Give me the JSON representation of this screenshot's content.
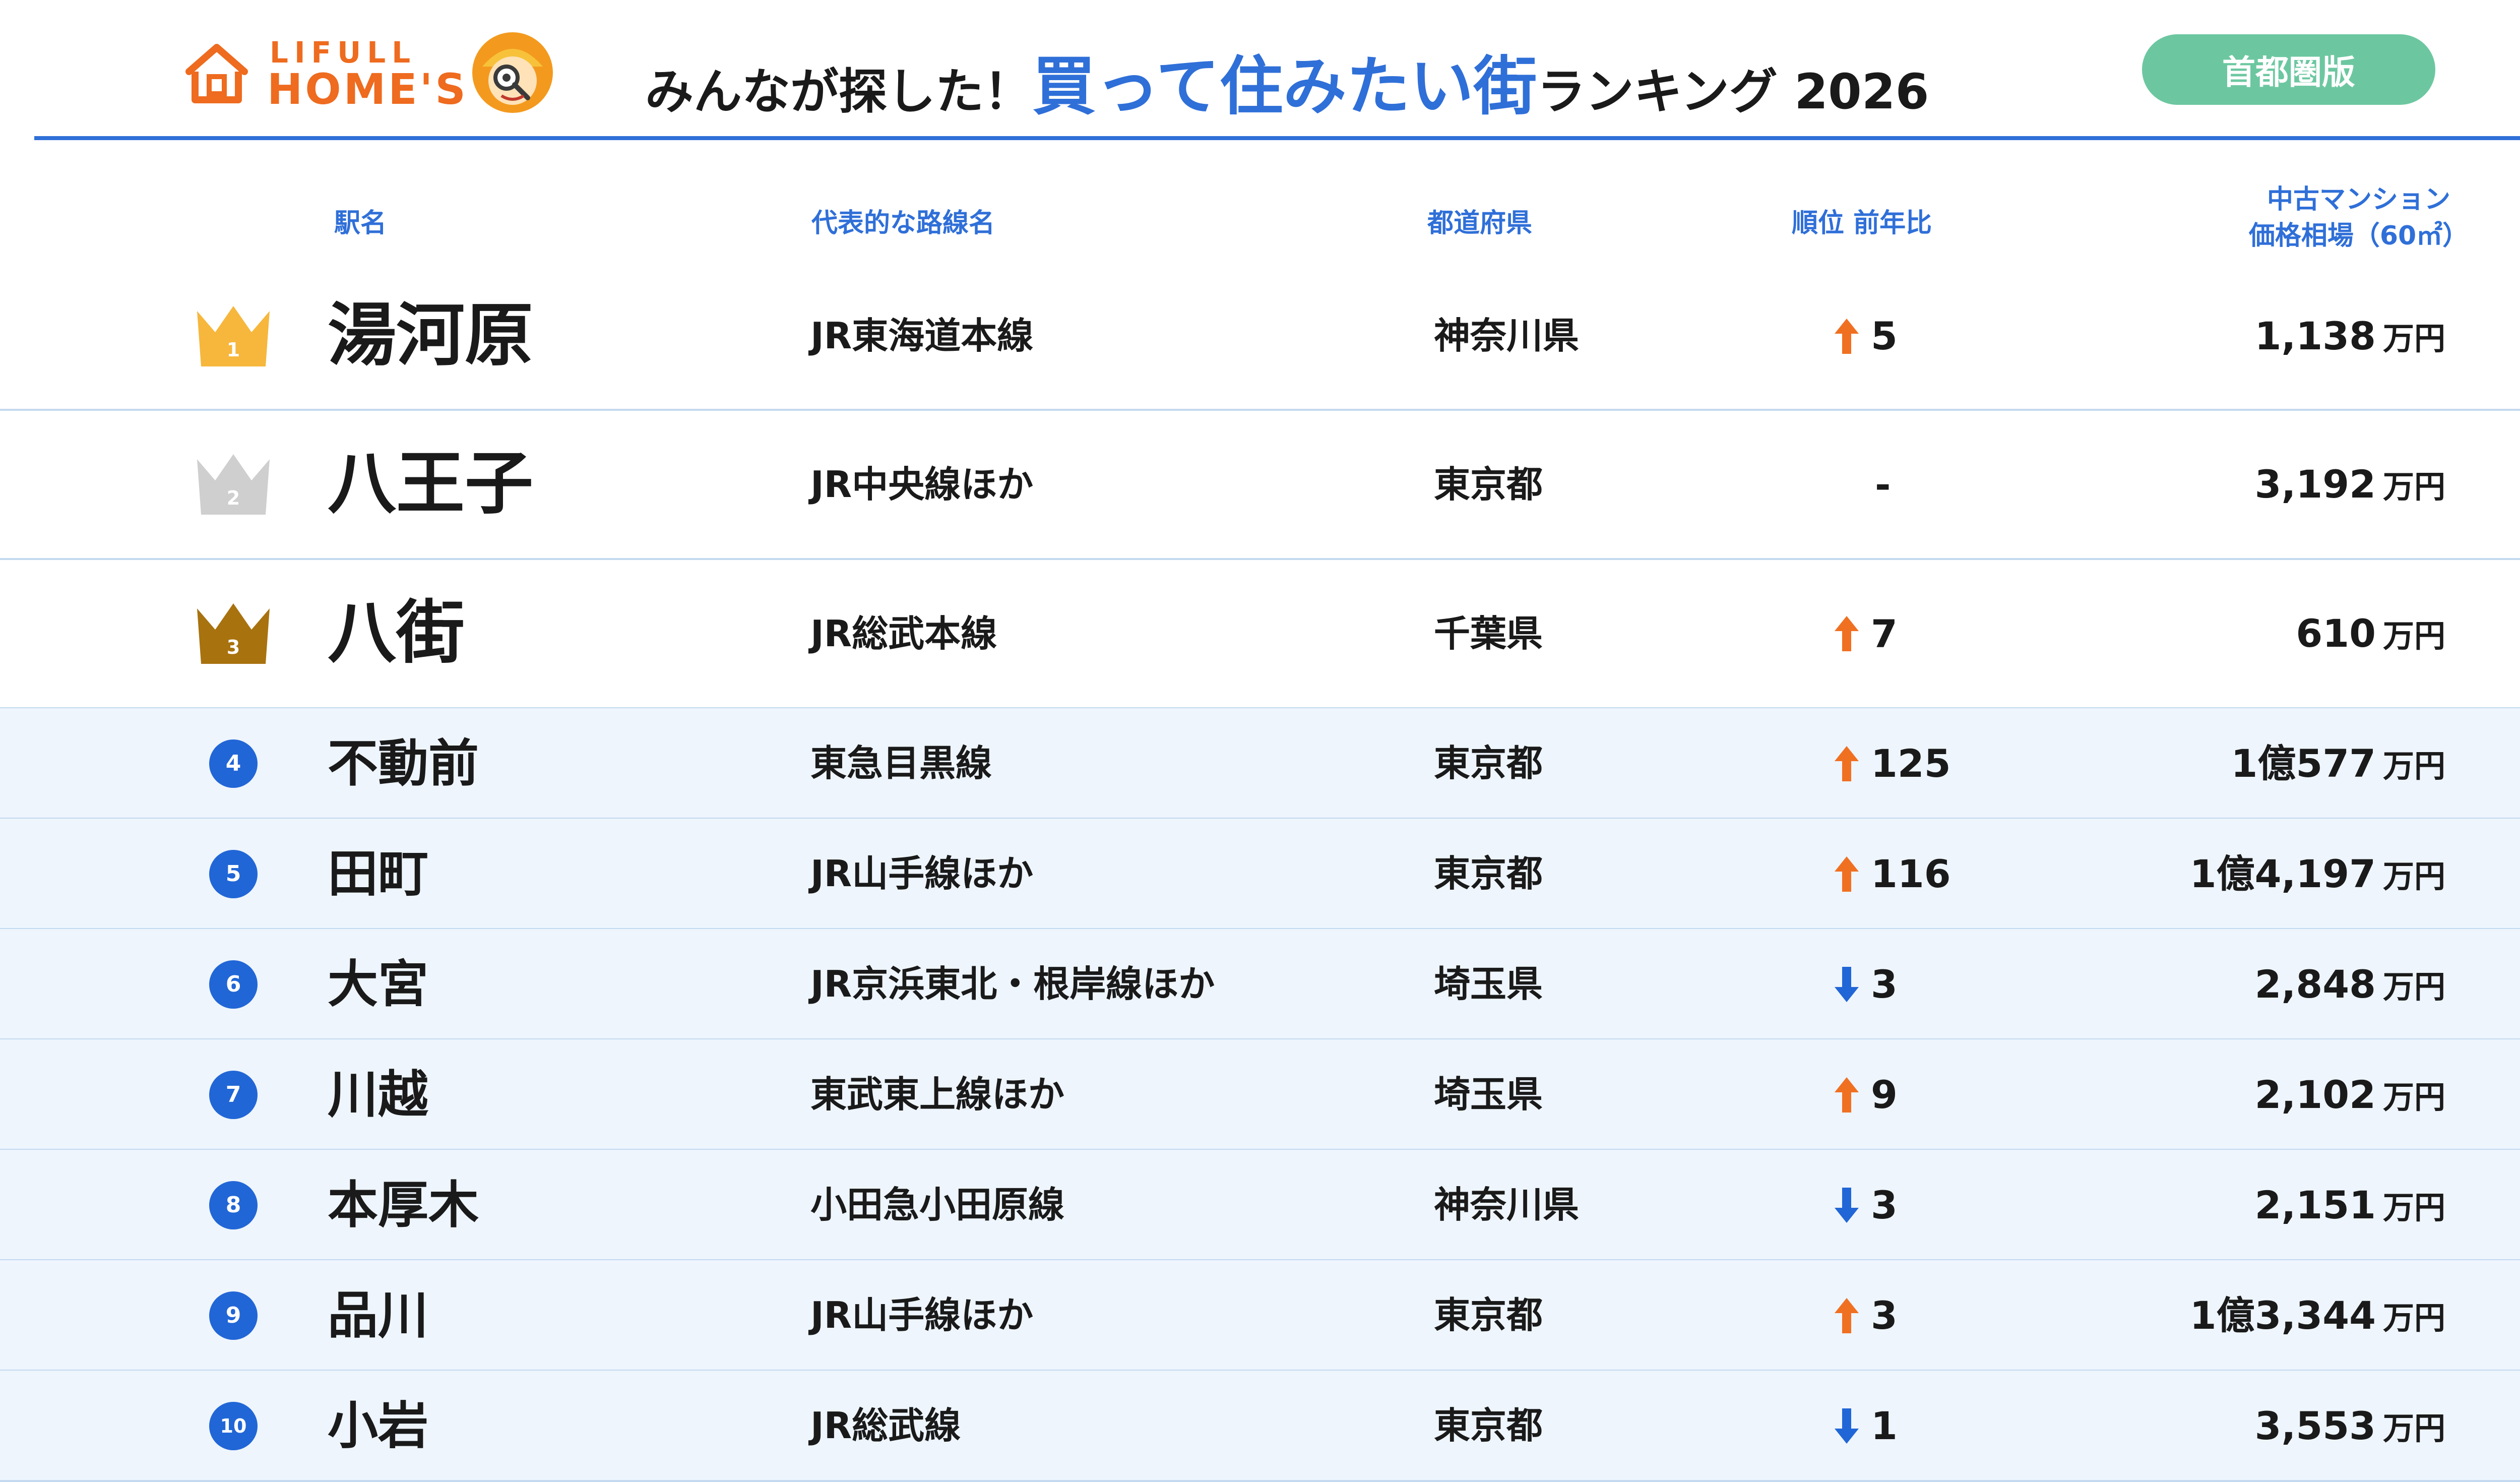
{
  "brand": {
    "logo_line1": "LIFULL",
    "logo_line2": "HOME'S",
    "color": "#ee6b1f"
  },
  "header": {
    "title_pre": "みんなが探した！",
    "title_main": "買って住みたい街",
    "title_post": "ランキング 2026",
    "accent_color": "#2f6fd8",
    "edition": "首都圏版",
    "edition_color": "#6cc7a0"
  },
  "columns": {
    "station": "駅名",
    "line": "代表的な路線名",
    "prefecture": "都道府県",
    "rank_change": "順位 前年比",
    "price_line1": "中古マンション",
    "price_line2": "価格相場（60㎡）"
  },
  "rows": [
    {
      "rank": "1",
      "station": "湯河原",
      "line": "JR東海道本線",
      "prefecture": "神奈川県",
      "change_dir": "up",
      "change": "5",
      "price": "1,138",
      "unit": "万円",
      "crown": "gold"
    },
    {
      "rank": "2",
      "station": "八王子",
      "line": "JR中央線ほか",
      "prefecture": "東京都",
      "change_dir": "none",
      "change": "-",
      "price": "3,192",
      "unit": "万円",
      "crown": "silver"
    },
    {
      "rank": "3",
      "station": "八街",
      "line": "JR総武本線",
      "prefecture": "千葉県",
      "change_dir": "up",
      "change": "7",
      "price": "610",
      "unit": "万円",
      "crown": "bronze"
    },
    {
      "rank": "4",
      "station": "不動前",
      "line": "東急目黒線",
      "prefecture": "東京都",
      "change_dir": "up",
      "change": "125",
      "price": "1億577",
      "unit": "万円"
    },
    {
      "rank": "5",
      "station": "田町",
      "line": "JR山手線ほか",
      "prefecture": "東京都",
      "change_dir": "up",
      "change": "116",
      "price": "1億4,197",
      "unit": "万円"
    },
    {
      "rank": "6",
      "station": "大宮",
      "line": "JR京浜東北・根岸線ほか",
      "prefecture": "埼玉県",
      "change_dir": "down",
      "change": "3",
      "price": "2,848",
      "unit": "万円"
    },
    {
      "rank": "7",
      "station": "川越",
      "line": "東武東上線ほか",
      "prefecture": "埼玉県",
      "change_dir": "up",
      "change": "9",
      "price": "2,102",
      "unit": "万円"
    },
    {
      "rank": "8",
      "station": "本厚木",
      "line": "小田急小田原線",
      "prefecture": "神奈川県",
      "change_dir": "down",
      "change": "3",
      "price": "2,151",
      "unit": "万円"
    },
    {
      "rank": "9",
      "station": "品川",
      "line": "JR山手線ほか",
      "prefecture": "東京都",
      "change_dir": "up",
      "change": "3",
      "price": "1億3,344",
      "unit": "万円"
    },
    {
      "rank": "10",
      "station": "小岩",
      "line": "JR総武線",
      "prefecture": "東京都",
      "change_dir": "down",
      "change": "1",
      "price": "3,553",
      "unit": "万円"
    }
  ],
  "colors": {
    "up_arrow": "#f07022",
    "down_arrow": "#2166d6",
    "gold": "#f6b73c",
    "silver": "#cfcfcf",
    "bronze": "#a8720f",
    "rank_badge": "#2166d6",
    "alt_row_bg": "#eef5fd"
  }
}
